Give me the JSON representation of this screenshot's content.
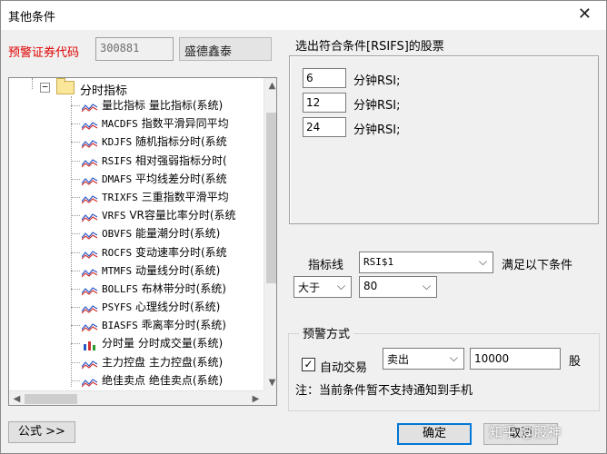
{
  "window": {
    "title": "其他条件",
    "close_glyph": "✕"
  },
  "stock": {
    "label": "预警证券代码",
    "code": "300881",
    "name": "盛德鑫泰"
  },
  "tree": {
    "expander": "−",
    "folder_label": "分时指标",
    "items": [
      {
        "code": "",
        "text": "量比指标  量比指标(系统)",
        "icon": "wave-chart-icon"
      },
      {
        "code": "MACDFS",
        "text": " 指数平滑异同平均",
        "icon": "wave-chart-icon"
      },
      {
        "code": "KDJFS",
        "text": " 随机指标分时(系统",
        "icon": "wave-chart-icon"
      },
      {
        "code": "RSIFS",
        "text": " 相对强弱指标分时(",
        "icon": "wave-chart-icon"
      },
      {
        "code": "DMAFS",
        "text": " 平均线差分时(系统",
        "icon": "wave-chart-icon"
      },
      {
        "code": "TRIXFS",
        "text": " 三重指数平滑平均",
        "icon": "wave-chart-icon"
      },
      {
        "code": "VRFS",
        "text": " VR容量比率分时(系统",
        "icon": "wave-chart-icon"
      },
      {
        "code": "OBVFS",
        "text": " 能量潮分时(系统)",
        "icon": "wave-chart-icon"
      },
      {
        "code": "ROCFS",
        "text": " 变动速率分时(系统",
        "icon": "wave-chart-icon"
      },
      {
        "code": "MTMFS",
        "text": " 动量线分时(系统)",
        "icon": "wave-chart-icon"
      },
      {
        "code": "BOLLFS",
        "text": " 布林带分时(系统)",
        "icon": "wave-chart-icon"
      },
      {
        "code": "PSYFS",
        "text": " 心理线分时(系统)",
        "icon": "wave-chart-icon"
      },
      {
        "code": "BIASFS",
        "text": " 乖离率分时(系统)",
        "icon": "wave-chart-icon"
      },
      {
        "code": "",
        "text": "分时量  分时成交量(系统)",
        "icon": "bar-chart-icon"
      },
      {
        "code": "",
        "text": "主力控盘  主力控盘(系统)",
        "icon": "wave-chart-icon"
      },
      {
        "code": "",
        "text": "绝佳卖点  绝佳卖点(系统)",
        "icon": "wave-chart-icon"
      }
    ]
  },
  "buttons": {
    "formula": "公式 >>",
    "ok": "确定",
    "cancel": "取消"
  },
  "params": {
    "title": "选出符合条件[RSIFS]的股票",
    "rows": [
      {
        "value": "6",
        "label": "分钟RSI;"
      },
      {
        "value": "12",
        "label": "分钟RSI;"
      },
      {
        "value": "24",
        "label": "分钟RSI;"
      }
    ]
  },
  "condition": {
    "indicator_label": "指标线",
    "indicator_value": "RSI$1",
    "satisfy_label": "满足以下条件",
    "operator": "大于",
    "threshold": "80"
  },
  "alert": {
    "title": "预警方式",
    "auto_trade_checked": true,
    "auto_trade_label": "自动交易",
    "side": "卖出",
    "quantity": "10000",
    "unit": "股",
    "note": "注：当前条件暂不支持通知到手机"
  },
  "watermark": "知乎 @股神"
}
